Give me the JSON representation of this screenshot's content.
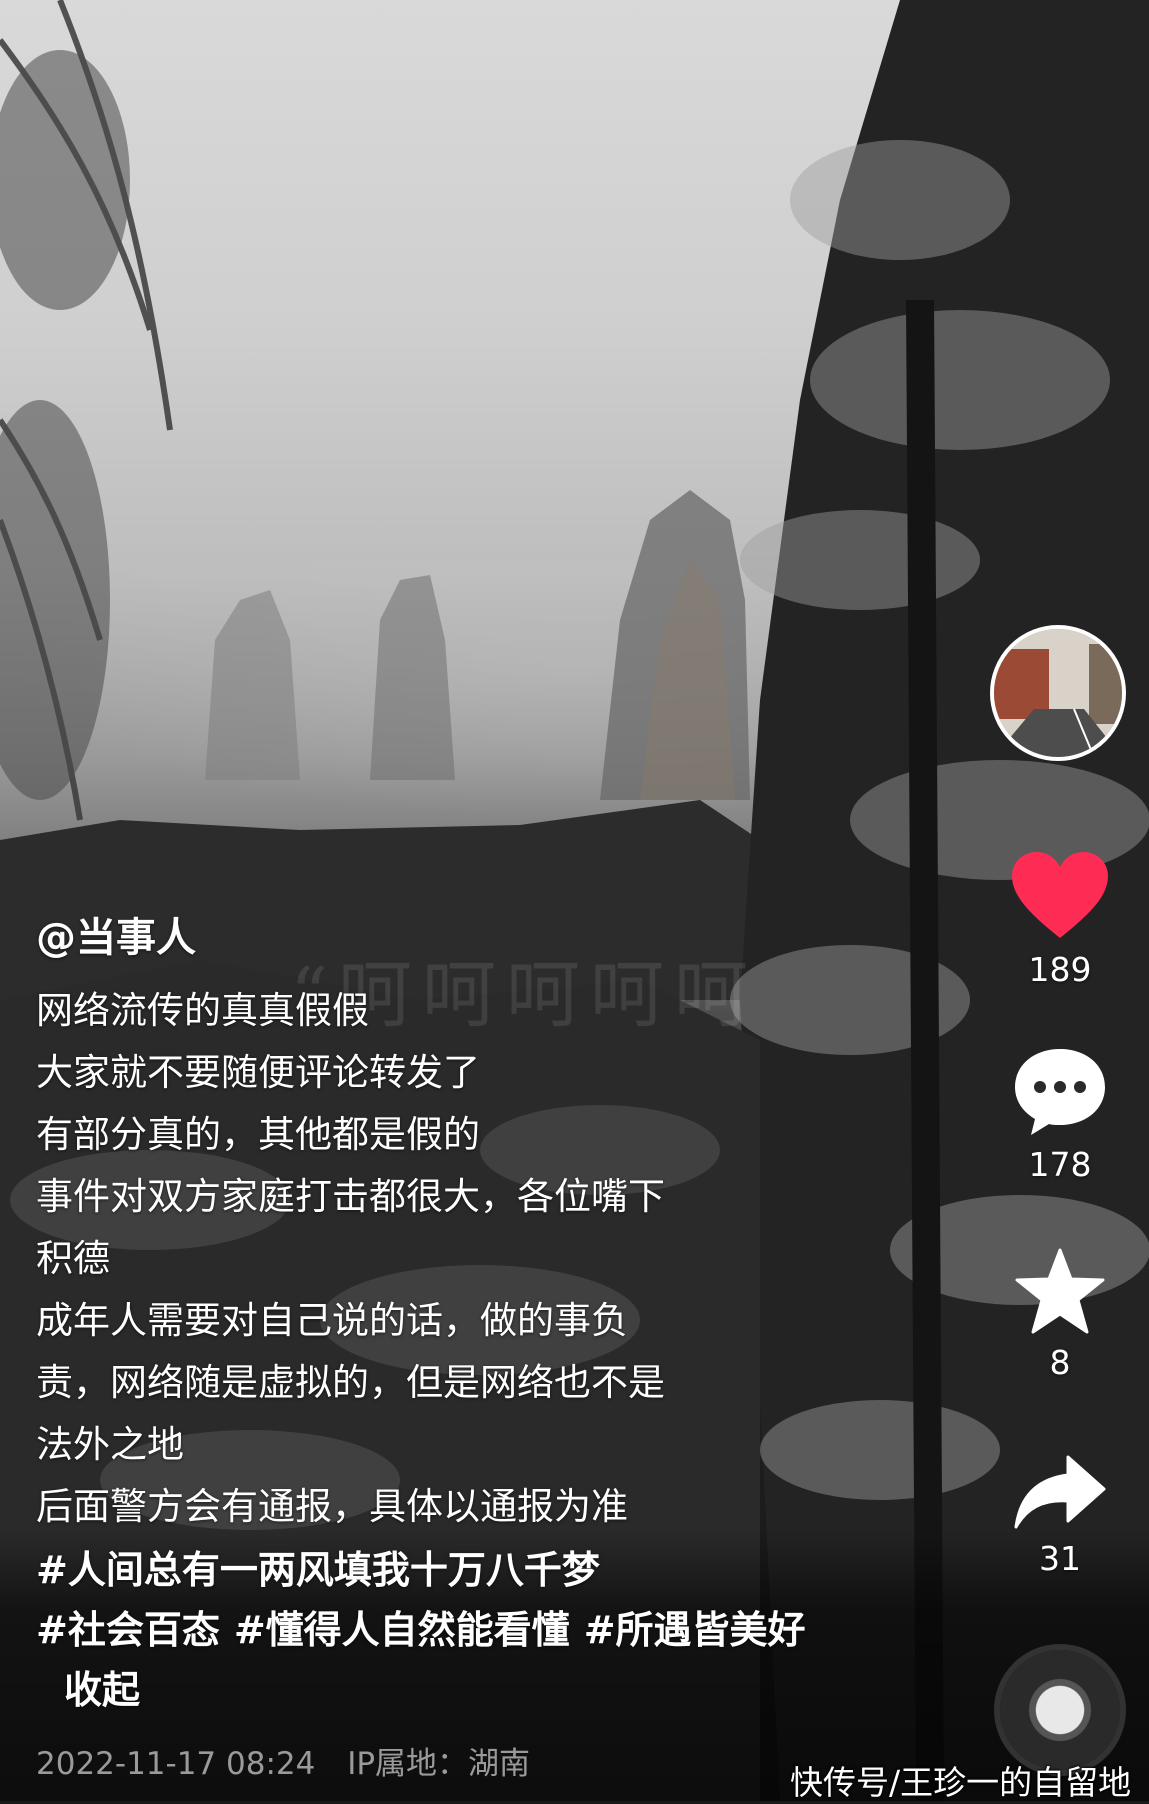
{
  "post": {
    "author": "@当事人",
    "caption_lines": [
      "网络流传的真真假假",
      "大家就不要随便评论转发了",
      "有部分真的，其他都是假的",
      "事件对双方家庭打击都很大，各位嘴下",
      "积德",
      "成年人需要对自己说的话，做的事负",
      "责，网络随是虚拟的，但是网络也不是",
      "法外之地",
      "后面警方会有通报，具体以通报为准"
    ],
    "tags": [
      "#人间总有一两风填我十万八千梦",
      "#社会百态",
      "#懂得人自然能看懂",
      "#所遇皆美好"
    ],
    "collapse_label": "收起",
    "date": "2022-11-17 08:24",
    "ip_location": "IP属地：湖南",
    "overlay_video_text": "“呵呵呵呵呵"
  },
  "actions": {
    "like_count": "189",
    "comment_count": "178",
    "favorite_count": "8",
    "share_count": "31"
  },
  "icons": {
    "like": "heart-icon",
    "comment": "comment-bubble-icon",
    "favorite": "star-icon",
    "share": "share-arrow-icon"
  },
  "colors": {
    "like": "#fe2c55",
    "meta": "#9a9a9a"
  },
  "watermark": "快传号/王珍一的自留地"
}
